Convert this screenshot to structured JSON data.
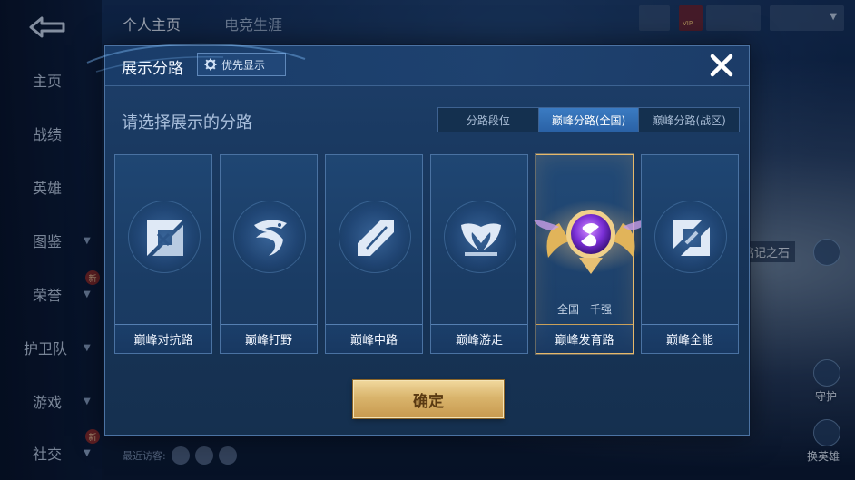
{
  "background": {
    "nav": {
      "items": [
        {
          "label": "主页",
          "active": true,
          "has_chevron": false,
          "badge": ""
        },
        {
          "label": "战绩",
          "active": false,
          "has_chevron": false,
          "badge": ""
        },
        {
          "label": "英雄",
          "active": false,
          "has_chevron": false,
          "badge": ""
        },
        {
          "label": "图鉴",
          "active": false,
          "has_chevron": true,
          "badge": ""
        },
        {
          "label": "荣誉",
          "active": false,
          "has_chevron": true,
          "badge": "新"
        },
        {
          "label": "护卫队",
          "active": false,
          "has_chevron": true,
          "badge": ""
        },
        {
          "label": "游戏",
          "active": false,
          "has_chevron": true,
          "badge": ""
        },
        {
          "label": "社交",
          "active": false,
          "has_chevron": true,
          "badge": "新"
        }
      ]
    },
    "top_tabs": [
      "个人主页",
      "电竞生涯"
    ],
    "recent_visitors_label": "最近访客:",
    "right_labels": {
      "stone": "铭记之石",
      "guard": "守护",
      "switch_hero": "换英雄"
    },
    "vip_badge": "VIP"
  },
  "modal": {
    "title": "展示分路",
    "priority_button": "优先显示",
    "subtitle": "请选择展示的分路",
    "tabs": [
      {
        "label": "分路段位",
        "active": false
      },
      {
        "label": "巅峰分路(全国)",
        "active": true
      },
      {
        "label": "巅峰分路(战区)",
        "active": false
      }
    ],
    "cards": [
      {
        "label": "巅峰对抗路",
        "icon": "clash-lane-icon",
        "selected": false,
        "rank": ""
      },
      {
        "label": "巅峰打野",
        "icon": "jungle-dragon-icon",
        "selected": false,
        "rank": ""
      },
      {
        "label": "巅峰中路",
        "icon": "mid-lane-icon",
        "selected": false,
        "rank": ""
      },
      {
        "label": "巅峰游走",
        "icon": "roam-wings-icon",
        "selected": false,
        "rank": ""
      },
      {
        "label": "巅峰发育路",
        "icon": "farm-lane-badge-icon",
        "selected": true,
        "rank": "全国一千强"
      },
      {
        "label": "巅峰全能",
        "icon": "all-round-icon",
        "selected": false,
        "rank": ""
      }
    ],
    "confirm_button": "确定"
  },
  "colors": {
    "selected_border": "#e6b86a",
    "confirm_gold": "#d9b46c",
    "active_tab": "#3b7bc2",
    "panel_bg": "#1a3b63"
  }
}
